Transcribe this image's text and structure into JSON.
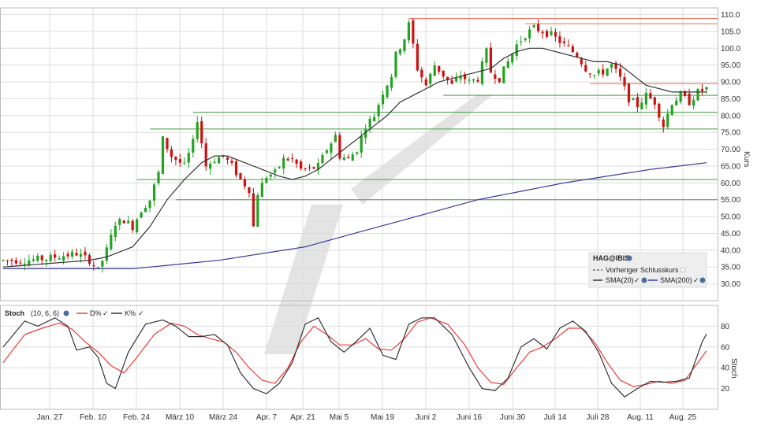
{
  "colors": {
    "up": "#22a322",
    "down": "#cc1111",
    "sma20": "#333333",
    "sma200": "#3a3a9a",
    "hline_green": "#3fa03f",
    "hline_red": "#ee6a50",
    "stoch_k": "#333333",
    "stoch_d": "#ee3b3b",
    "grid": "#dcdcdc",
    "watermark": "#e4e4e4",
    "legend_bg": "#eeeeee"
  },
  "x_axis": {
    "labels": [
      "Jan. 27",
      "Feb. 10",
      "Feb. 24",
      "März 10",
      "März 24",
      "Apr. 7",
      "Apr. 21",
      "Mai 5",
      "Mai 19",
      "Juni 2",
      "Juni 16",
      "Juni 30",
      "Juli 14",
      "Juli 28",
      "Aug. 11",
      "Aug. 25"
    ]
  },
  "price_axis": {
    "label": "Kurs",
    "ticks": [
      "110.0",
      "105.0",
      "100.0",
      "95.00",
      "90.00",
      "85.00",
      "80.00",
      "75.00",
      "70.00",
      "65.00",
      "60.00",
      "55.00",
      "50.00",
      "45.00",
      "40.00",
      "35.00",
      "30.00"
    ]
  },
  "stoch_axis": {
    "label": "Stoch",
    "ticks": [
      "80",
      "60",
      "40",
      "20"
    ]
  },
  "legend": {
    "title": "HAG@IBIS",
    "prev_close": "Vorheriger Schlusskurs",
    "sma20": "SMA(20)",
    "sma200": "SMA(200)"
  },
  "stoch_header": {
    "name": "Stoch",
    "params": "(10, 6, 6)",
    "d_label": "D%",
    "k_label": "K%"
  },
  "chart_data": {
    "type": "candlestick",
    "price_ylim": [
      25,
      112
    ],
    "stoch_ylim": [
      0,
      100
    ],
    "x_range": [
      -4,
      152
    ],
    "x_ticks": [
      7,
      17,
      27,
      37,
      47,
      57,
      67,
      75,
      85,
      95,
      105,
      115,
      125,
      135,
      145,
      155
    ],
    "price_anchors": [
      [
        0,
        37
      ],
      [
        5,
        37
      ],
      [
        10,
        37.5
      ],
      [
        12,
        38
      ],
      [
        17,
        39
      ],
      [
        20,
        37
      ],
      [
        22,
        34
      ],
      [
        24,
        40
      ],
      [
        26,
        48
      ],
      [
        28,
        49
      ],
      [
        30,
        47
      ],
      [
        32,
        52
      ],
      [
        34,
        55
      ],
      [
        36,
        63
      ],
      [
        37,
        73
      ],
      [
        39,
        68
      ],
      [
        42,
        65
      ],
      [
        44,
        72
      ],
      [
        45,
        79
      ],
      [
        47,
        65
      ],
      [
        49,
        67
      ],
      [
        51,
        68
      ],
      [
        53,
        65
      ],
      [
        55,
        61
      ],
      [
        57,
        58
      ],
      [
        58,
        47
      ],
      [
        59,
        57
      ],
      [
        61,
        62
      ],
      [
        63,
        63
      ],
      [
        65,
        67
      ],
      [
        67,
        67
      ],
      [
        69,
        64
      ],
      [
        71,
        64
      ],
      [
        73,
        65
      ],
      [
        75,
        70
      ],
      [
        77,
        74
      ],
      [
        78,
        68
      ],
      [
        80,
        67
      ],
      [
        82,
        70
      ],
      [
        84,
        77
      ],
      [
        86,
        80
      ],
      [
        88,
        87
      ],
      [
        90,
        92
      ],
      [
        91,
        98
      ],
      [
        93,
        103
      ],
      [
        94,
        107
      ],
      [
        95,
        101
      ],
      [
        96,
        94
      ],
      [
        98,
        89
      ],
      [
        100,
        95
      ],
      [
        102,
        92
      ],
      [
        104,
        89
      ],
      [
        106,
        92
      ],
      [
        108,
        90
      ],
      [
        110,
        91
      ],
      [
        112,
        99
      ],
      [
        113,
        93
      ],
      [
        115,
        91
      ],
      [
        117,
        96
      ],
      [
        119,
        101
      ],
      [
        121,
        104
      ],
      [
        123,
        106
      ],
      [
        125,
        105
      ],
      [
        127,
        104
      ],
      [
        129,
        102
      ],
      [
        131,
        100
      ],
      [
        133,
        98
      ],
      [
        135,
        94
      ],
      [
        137,
        92
      ],
      [
        139,
        93
      ],
      [
        141,
        95
      ],
      [
        143,
        91
      ],
      [
        145,
        85
      ],
      [
        147,
        83
      ],
      [
        149,
        86
      ],
      [
        151,
        84
      ],
      [
        153,
        77
      ],
      [
        155,
        84
      ],
      [
        157,
        86
      ],
      [
        159,
        84
      ],
      [
        161,
        87
      ],
      [
        163,
        88
      ]
    ],
    "sma20_anchors": [
      [
        0,
        35
      ],
      [
        20,
        37
      ],
      [
        24,
        38
      ],
      [
        30,
        41
      ],
      [
        34,
        47
      ],
      [
        38,
        55
      ],
      [
        42,
        61
      ],
      [
        46,
        66
      ],
      [
        49,
        68
      ],
      [
        52,
        68
      ],
      [
        56,
        66
      ],
      [
        60,
        64
      ],
      [
        64,
        62
      ],
      [
        67,
        61
      ],
      [
        70,
        62
      ],
      [
        73,
        64
      ],
      [
        76,
        67
      ],
      [
        79,
        70
      ],
      [
        82,
        73
      ],
      [
        86,
        77
      ],
      [
        89,
        80
      ],
      [
        92,
        84
      ],
      [
        95,
        86
      ],
      [
        98,
        88
      ],
      [
        101,
        90
      ],
      [
        104,
        91
      ],
      [
        107,
        92
      ],
      [
        110,
        93
      ],
      [
        113,
        94
      ],
      [
        116,
        97
      ],
      [
        119,
        99
      ],
      [
        122,
        100
      ],
      [
        125,
        100
      ],
      [
        128,
        99
      ],
      [
        131,
        98
      ],
      [
        134,
        97
      ],
      [
        137,
        96
      ],
      [
        140,
        96
      ],
      [
        143,
        95
      ],
      [
        146,
        92
      ],
      [
        149,
        89
      ],
      [
        152,
        88
      ],
      [
        155,
        87
      ],
      [
        158,
        87
      ],
      [
        161,
        87
      ],
      [
        163,
        87
      ]
    ],
    "sma200_anchors": [
      [
        0,
        34.5
      ],
      [
        30,
        34.5
      ],
      [
        50,
        37
      ],
      [
        70,
        41
      ],
      [
        90,
        48
      ],
      [
        110,
        55
      ],
      [
        130,
        60
      ],
      [
        150,
        64
      ],
      [
        163,
        66
      ]
    ],
    "hlines": [
      {
        "value": 108.8,
        "x1": 94,
        "x2": 164,
        "color": "red"
      },
      {
        "value": 107.3,
        "x1": 121,
        "x2": 164,
        "color": "red"
      },
      {
        "value": 89.5,
        "x1": 136,
        "x2": 164,
        "color": "red"
      },
      {
        "value": 86,
        "x1": 102,
        "x2": 164,
        "color": "green"
      },
      {
        "value": 81,
        "x1": 44,
        "x2": 164,
        "color": "green"
      },
      {
        "value": 76,
        "x1": 34,
        "x2": 164,
        "color": "green"
      },
      {
        "value": 61,
        "x1": 31,
        "x2": 164,
        "color": "green"
      },
      {
        "value": 55,
        "x1": 40,
        "x2": 164,
        "color": "green"
      }
    ],
    "stoch_k_anchors": [
      [
        0,
        60
      ],
      [
        5,
        85
      ],
      [
        8,
        80
      ],
      [
        12,
        88
      ],
      [
        15,
        80
      ],
      [
        17,
        57
      ],
      [
        20,
        60
      ],
      [
        22,
        50
      ],
      [
        24,
        25
      ],
      [
        26,
        20
      ],
      [
        29,
        55
      ],
      [
        33,
        82
      ],
      [
        37,
        86
      ],
      [
        40,
        80
      ],
      [
        43,
        70
      ],
      [
        46,
        70
      ],
      [
        49,
        72
      ],
      [
        52,
        62
      ],
      [
        55,
        35
      ],
      [
        58,
        20
      ],
      [
        61,
        15
      ],
      [
        64,
        25
      ],
      [
        67,
        45
      ],
      [
        70,
        82
      ],
      [
        73,
        88
      ],
      [
        76,
        65
      ],
      [
        79,
        55
      ],
      [
        82,
        66
      ],
      [
        85,
        78
      ],
      [
        88,
        52
      ],
      [
        91,
        48
      ],
      [
        94,
        82
      ],
      [
        97,
        88
      ],
      [
        100,
        88
      ],
      [
        104,
        72
      ],
      [
        108,
        40
      ],
      [
        111,
        20
      ],
      [
        114,
        18
      ],
      [
        117,
        30
      ],
      [
        120,
        60
      ],
      [
        123,
        68
      ],
      [
        126,
        58
      ],
      [
        129,
        78
      ],
      [
        132,
        85
      ],
      [
        135,
        75
      ],
      [
        138,
        55
      ],
      [
        141,
        25
      ],
      [
        144,
        12
      ],
      [
        147,
        20
      ],
      [
        150,
        27
      ],
      [
        153,
        26
      ],
      [
        156,
        27
      ],
      [
        159,
        30
      ],
      [
        162,
        65
      ],
      [
        164,
        80
      ]
    ],
    "stoch_d_anchors": [
      [
        0,
        45
      ],
      [
        5,
        72
      ],
      [
        9,
        78
      ],
      [
        13,
        83
      ],
      [
        16,
        77
      ],
      [
        19,
        65
      ],
      [
        22,
        55
      ],
      [
        25,
        42
      ],
      [
        28,
        35
      ],
      [
        31,
        50
      ],
      [
        35,
        72
      ],
      [
        39,
        83
      ],
      [
        42,
        80
      ],
      [
        45,
        72
      ],
      [
        48,
        68
      ],
      [
        51,
        65
      ],
      [
        54,
        55
      ],
      [
        57,
        40
      ],
      [
        60,
        28
      ],
      [
        63,
        25
      ],
      [
        66,
        40
      ],
      [
        69,
        65
      ],
      [
        72,
        80
      ],
      [
        75,
        72
      ],
      [
        78,
        62
      ],
      [
        81,
        62
      ],
      [
        84,
        68
      ],
      [
        87,
        58
      ],
      [
        90,
        57
      ],
      [
        93,
        68
      ],
      [
        96,
        84
      ],
      [
        99,
        88
      ],
      [
        103,
        82
      ],
      [
        107,
        62
      ],
      [
        110,
        40
      ],
      [
        113,
        26
      ],
      [
        116,
        24
      ],
      [
        119,
        40
      ],
      [
        122,
        55
      ],
      [
        125,
        60
      ],
      [
        128,
        68
      ],
      [
        131,
        78
      ],
      [
        134,
        78
      ],
      [
        137,
        65
      ],
      [
        140,
        45
      ],
      [
        143,
        28
      ],
      [
        146,
        22
      ],
      [
        149,
        24
      ],
      [
        152,
        27
      ],
      [
        155,
        25
      ],
      [
        158,
        28
      ],
      [
        161,
        45
      ],
      [
        164,
        62
      ]
    ]
  }
}
